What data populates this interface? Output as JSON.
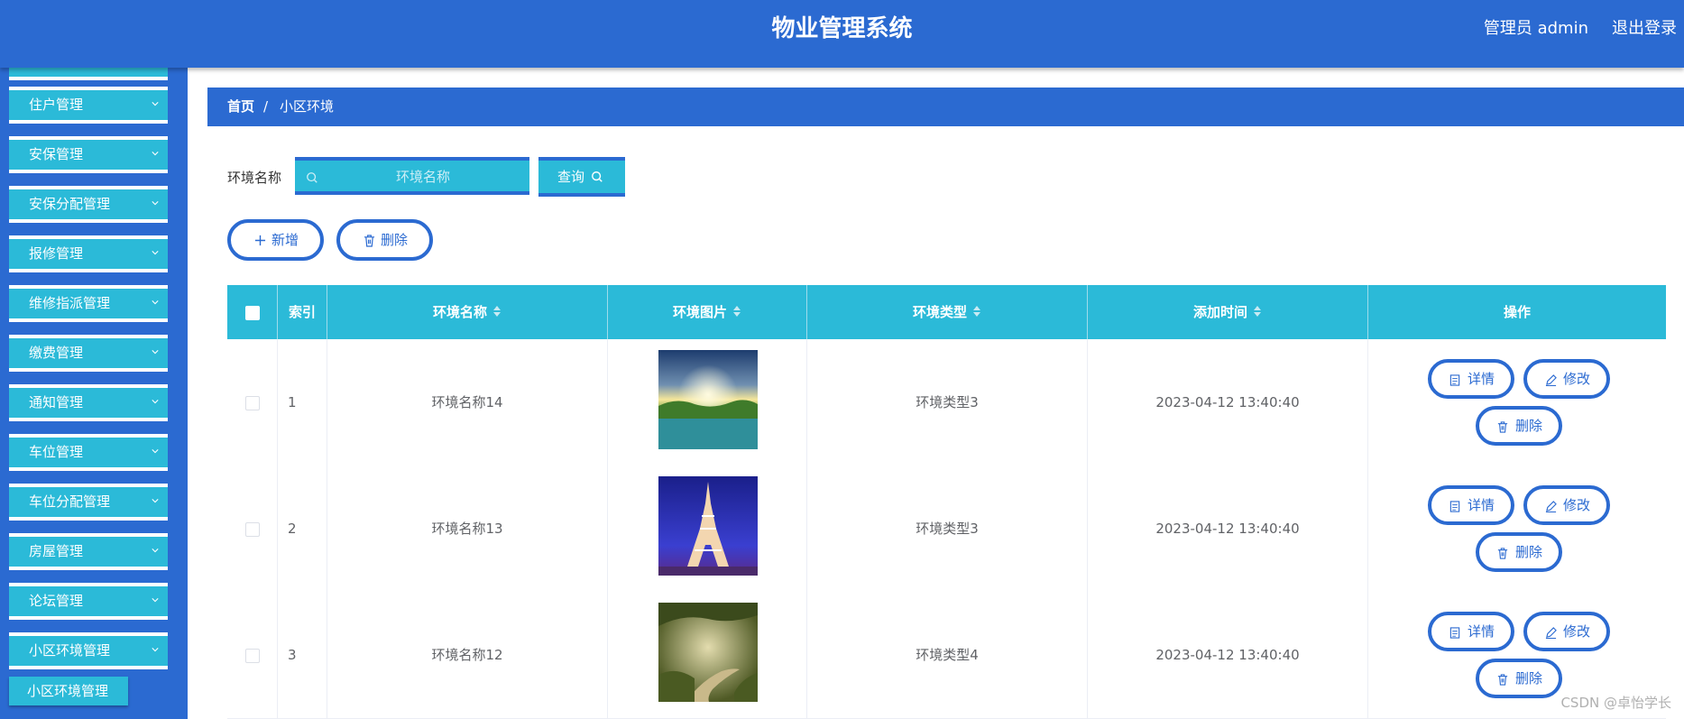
{
  "header": {
    "title": "物业管理系统",
    "user": "管理员 admin",
    "logout": "退出登录"
  },
  "sidebar": {
    "items": [
      {
        "label": "住户管理"
      },
      {
        "label": "安保管理"
      },
      {
        "label": "安保分配管理"
      },
      {
        "label": "报修管理"
      },
      {
        "label": "维修指派管理"
      },
      {
        "label": "缴费管理"
      },
      {
        "label": "通知管理"
      },
      {
        "label": "车位管理"
      },
      {
        "label": "车位分配管理"
      },
      {
        "label": "房屋管理"
      },
      {
        "label": "论坛管理"
      },
      {
        "label": "小区环境管理"
      }
    ],
    "sub_item": "小区环境管理"
  },
  "breadcrumb": {
    "home": "首页",
    "sep": "/",
    "current": "小区环境"
  },
  "search": {
    "label": "环境名称",
    "placeholder": "环境名称",
    "query_label": "查询"
  },
  "actions": {
    "add_label": "新增",
    "delete_label": "删除"
  },
  "table": {
    "headers": {
      "index": "索引",
      "name": "环境名称",
      "image": "环境图片",
      "type": "环境类型",
      "time": "添加时间",
      "ops": "操作"
    },
    "op_labels": {
      "detail": "详情",
      "edit": "修改",
      "delete": "删除"
    },
    "rows": [
      {
        "index": "1",
        "name": "环境名称14",
        "image": "lake-sunset-image",
        "type": "环境类型3",
        "time": "2023-04-12 13:40:40"
      },
      {
        "index": "2",
        "name": "环境名称13",
        "image": "eiffel-tower-image",
        "type": "环境类型3",
        "time": "2023-04-12 13:40:40"
      },
      {
        "index": "3",
        "name": "环境名称12",
        "image": "forest-path-image",
        "type": "环境类型4",
        "time": "2023-04-12 13:40:40"
      }
    ]
  },
  "watermark": "CSDN @卓怡学长",
  "colors": {
    "primary": "#2b6ad1",
    "accent": "#2bbad8"
  }
}
